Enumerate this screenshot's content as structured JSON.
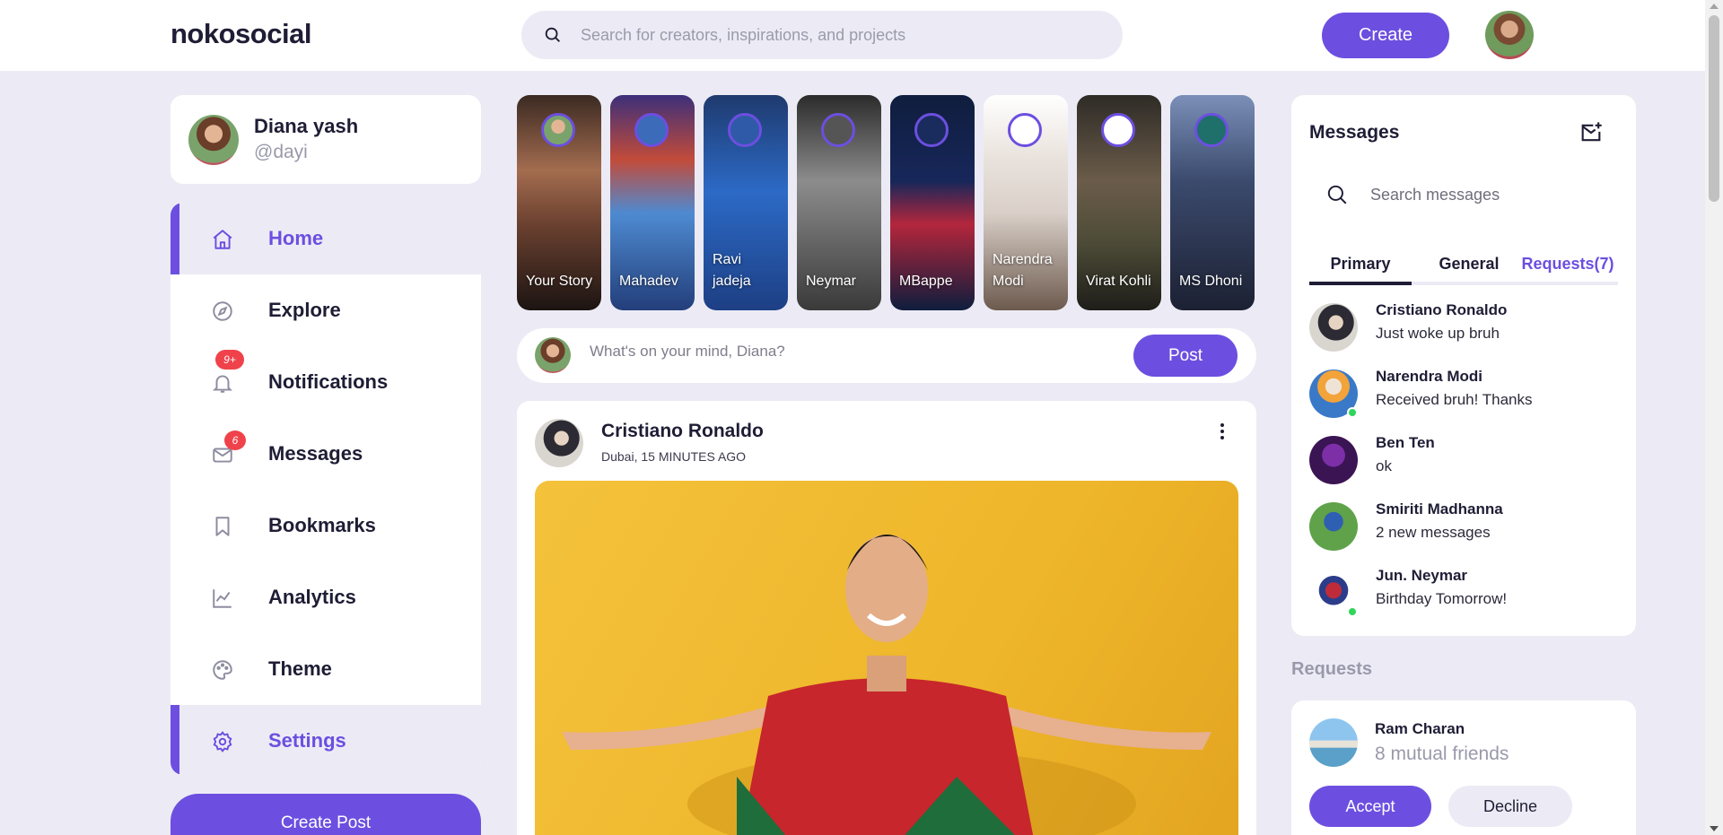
{
  "brand": {
    "logo_text": "nokosocial",
    "accent": "#6c4fe0"
  },
  "header": {
    "search_placeholder": "Search for creators, inspirations, and projects",
    "create_label": "Create"
  },
  "profile": {
    "name": "Diana yash",
    "handle": "@dayi"
  },
  "sidebar": {
    "items": [
      {
        "label": "Home",
        "icon": "home-icon",
        "active": true
      },
      {
        "label": "Explore",
        "icon": "compass-icon"
      },
      {
        "label": "Notifications",
        "icon": "bell-icon",
        "badge": "9+"
      },
      {
        "label": "Messages",
        "icon": "mail-icon",
        "badge": "6"
      },
      {
        "label": "Bookmarks",
        "icon": "bookmark-icon"
      },
      {
        "label": "Analytics",
        "icon": "chart-line-icon"
      },
      {
        "label": "Theme",
        "icon": "palette-icon"
      },
      {
        "label": "Settings",
        "icon": "gear-icon",
        "active": true
      }
    ],
    "create_post_label": "Create Post"
  },
  "stories": [
    {
      "name": "Your Story"
    },
    {
      "name": "Mahadev"
    },
    {
      "name": "Ravi jadeja"
    },
    {
      "name": "Neymar"
    },
    {
      "name": "MBappe"
    },
    {
      "name": "Narendra Modi"
    },
    {
      "name": "Virat Kohli"
    },
    {
      "name": "MS Dhoni"
    }
  ],
  "composer": {
    "placeholder": "What's on your mind, Diana?",
    "post_label": "Post"
  },
  "feed": {
    "post": {
      "author": "Cristiano Ronaldo",
      "meta": "Dubai, 15 MINUTES AGO"
    }
  },
  "messages": {
    "title": "Messages",
    "search_placeholder": "Search messages",
    "tabs": [
      "Primary",
      "General",
      "Requests(7)"
    ],
    "items": [
      {
        "name": "Cristiano Ronaldo",
        "text": "Just woke up bruh",
        "online": false
      },
      {
        "name": "Narendra Modi",
        "text": "Received bruh! Thanks",
        "online": true
      },
      {
        "name": "Ben Ten",
        "text": "ok",
        "online": false
      },
      {
        "name": "Smiriti Madhanna",
        "text": "2 new messages",
        "online": false
      },
      {
        "name": "Jun. Neymar",
        "text": "Birthday Tomorrow!",
        "online": true
      }
    ]
  },
  "requests": {
    "title": "Requests",
    "item": {
      "name": "Ram Charan",
      "mutual": "8 mutual friends",
      "accept_label": "Accept",
      "decline_label": "Decline"
    }
  }
}
